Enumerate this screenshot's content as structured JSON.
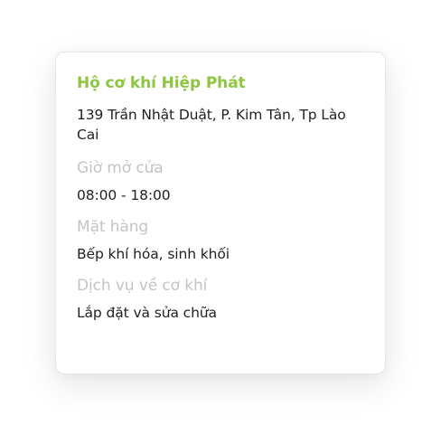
{
  "card": {
    "title": "Hộ cơ khí Hiệp Phát",
    "address": "139 Trần Nhật Duật, P. Kim Tân, Tp Lào Cai",
    "hours_label": "Giờ mở cửa",
    "hours_value": "08:00 - 18:00",
    "goods_label": "Mặt hàng",
    "goods_value": "Bếp khí hóa, sinh khối",
    "service_label": "Dịch vụ về cơ khí",
    "service_value": "Lắp đặt và sửa chữa"
  },
  "colors": {
    "accent": "#8dc63f",
    "label": "#c4c4c4",
    "text": "#222222"
  }
}
